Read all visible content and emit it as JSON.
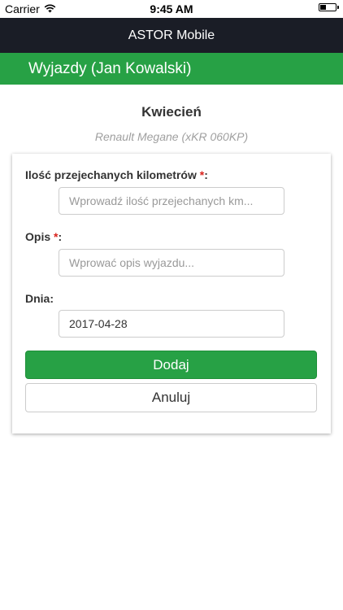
{
  "status_bar": {
    "carrier": "Carrier",
    "time": "9:45 AM",
    "icons": [
      "wifi-icon",
      "battery-icon"
    ]
  },
  "app_bar": {
    "title": "ASTOR Mobile"
  },
  "page_header": {
    "title": "Wyjazdy (Jan Kowalski)"
  },
  "main": {
    "month": "Kwiecień",
    "vehicle": "Renault Megane (xKR 060KP)"
  },
  "form": {
    "required_marker": "*",
    "label_suffix": ":",
    "km": {
      "label": "Ilość przejechanych kilometrów",
      "placeholder": "Wprowadź ilość przejechanych km...",
      "value": ""
    },
    "description": {
      "label": "Opis",
      "placeholder": "Wprować opis wyjazdu...",
      "value": ""
    },
    "date": {
      "label": "Dnia:",
      "value": "2017-04-28"
    },
    "submit_label": "Dodaj",
    "cancel_label": "Anuluj"
  },
  "colors": {
    "app_bar_bg": "#1a1d26",
    "accent_green": "#27a145",
    "required_red": "#d9231d",
    "muted_text": "#a0a0a0"
  }
}
